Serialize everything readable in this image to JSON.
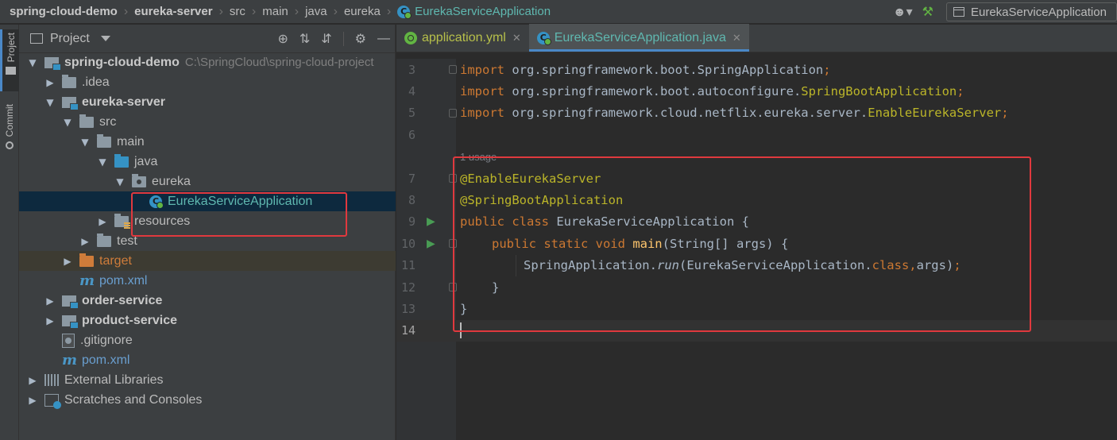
{
  "breadcrumb": [
    "spring-cloud-demo",
    "eureka-server",
    "src",
    "main",
    "java",
    "eureka",
    "EurekaServiceApplication"
  ],
  "run_config": {
    "label": "EurekaServiceApplication"
  },
  "toolstrip": {
    "project": "Project",
    "commit": "Commit"
  },
  "project_panel": {
    "title": "Project",
    "tree": [
      {
        "label": "spring-cloud-demo",
        "hint": "C:\\SpringCloud\\spring-cloud-project"
      },
      {
        "label": ".idea"
      },
      {
        "label": "eureka-server"
      },
      {
        "label": "src"
      },
      {
        "label": "main"
      },
      {
        "label": "java"
      },
      {
        "label": "eureka"
      },
      {
        "label": "EurekaServiceApplication"
      },
      {
        "label": "resources"
      },
      {
        "label": "test"
      },
      {
        "label": "target"
      },
      {
        "label": "pom.xml"
      },
      {
        "label": "order-service"
      },
      {
        "label": "product-service"
      },
      {
        "label": ".gitignore"
      },
      {
        "label": "pom.xml"
      },
      {
        "label": "External Libraries"
      },
      {
        "label": "Scratches and Consoles"
      }
    ]
  },
  "editor": {
    "tabs": [
      {
        "label": "application.yml",
        "active": false
      },
      {
        "label": "EurekaServiceApplication.java",
        "active": true
      }
    ],
    "usage_hint": "1 usage",
    "line_numbers": [
      "3",
      "4",
      "5",
      "6",
      "7",
      "8",
      "9",
      "10",
      "11",
      "12",
      "13",
      "14"
    ],
    "code": {
      "l3_kw": "import",
      "l3_rest": " org.springframework.boot.SpringApplication",
      "l3_end": ";",
      "l4_kw": "import",
      "l4_rest": " org.springframework.boot.autoconfigure.",
      "l4_cls": "SpringBootApplication",
      "l4_end": ";",
      "l5_kw": "import",
      "l5_rest": " org.springframework.cloud.netflix.eureka.server.",
      "l5_cls": "EnableEurekaServer",
      "l5_end": ";",
      "l7": "@EnableEurekaServer",
      "l8": "@SpringBootApplication",
      "l9_kw": "public class",
      "l9_rest": " EurekaServiceApplication {",
      "l10_kw": "public static void",
      "l10_fn": " main",
      "l10_rest": "(String[] args) {",
      "l11_a": "SpringApplication.",
      "l11_fn": "run",
      "l11_b": "(EurekaServiceApplication.",
      "l11_kw": "class",
      "l11_c": ",",
      "l11_d": "args)",
      "l11_e": ";",
      "l12": "}",
      "l13": "}"
    }
  },
  "colors": {
    "accent": "#4a88c7",
    "highlight_box": "#e0393e",
    "keyword": "#cc7832",
    "annotation": "#bbb529",
    "method": "#ffc66d"
  }
}
